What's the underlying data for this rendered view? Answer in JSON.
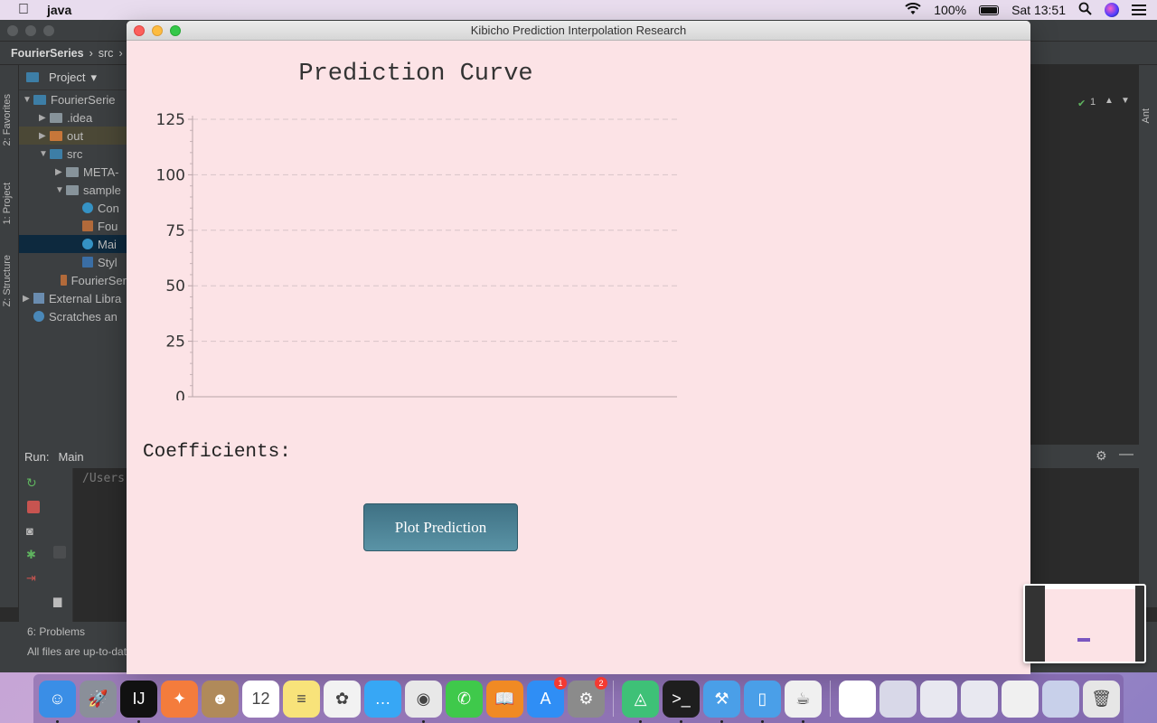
{
  "menubar": {
    "app_name": "java",
    "battery": "100%",
    "clock": "Sat 13:51"
  },
  "ide": {
    "breadcrumb": [
      "FourierSeries",
      "src"
    ],
    "project_label": "Project",
    "side_tabs": [
      "2: Favorites",
      "1: Project",
      "Z: Structure"
    ],
    "right_tab": "Ant",
    "tree": [
      {
        "label": "FourierSerie",
        "kind": "module",
        "indent": 0
      },
      {
        "label": ".idea",
        "kind": "folder",
        "indent": 1
      },
      {
        "label": "out",
        "kind": "folder-orange",
        "indent": 1
      },
      {
        "label": "src",
        "kind": "folder-blue",
        "indent": 1
      },
      {
        "label": "META-",
        "kind": "folder",
        "indent": 2
      },
      {
        "label": "sample",
        "kind": "folder",
        "indent": 2
      },
      {
        "label": "Con",
        "kind": "class",
        "indent": 3
      },
      {
        "label": "Fou",
        "kind": "file",
        "indent": 3
      },
      {
        "label": "Mai",
        "kind": "class",
        "indent": 3
      },
      {
        "label": "Styl",
        "kind": "css",
        "indent": 3
      },
      {
        "label": "FourierSer",
        "kind": "file",
        "indent": 2
      },
      {
        "label": "External Libra",
        "kind": "lib",
        "indent": 0
      },
      {
        "label": "Scratches an",
        "kind": "scratch",
        "indent": 0
      }
    ],
    "run_label": "Run:",
    "run_tab": "Main",
    "console_text": "/Users",
    "problems_tab": "6: Problems",
    "status_text": "All files are up-to-date",
    "inspection_count": "1"
  },
  "window": {
    "title": "Kibicho Prediction Interpolation Research",
    "coefficients_label": "Coefficients:",
    "plot_button_label": "Plot Prediction"
  },
  "chart_data": {
    "type": "line",
    "title": "Prediction Curve",
    "xlabel": "",
    "ylabel": "",
    "ylim": [
      0,
      125
    ],
    "y_ticks": [
      0,
      25,
      50,
      75,
      100,
      125
    ],
    "grid": true,
    "series": []
  },
  "dock": {
    "items": [
      {
        "name": "finder",
        "color": "#3a8ee6",
        "glyph": "☺",
        "running": true
      },
      {
        "name": "launchpad",
        "color": "#8a8f99",
        "glyph": "🚀",
        "running": false
      },
      {
        "name": "intellij",
        "color": "#111111",
        "glyph": "IJ",
        "running": true
      },
      {
        "name": "swift-playgrounds",
        "color": "#f47c3c",
        "glyph": "✦",
        "running": false
      },
      {
        "name": "contacts",
        "color": "#b08a5a",
        "glyph": "☻",
        "running": false
      },
      {
        "name": "calendar",
        "color": "#ffffff",
        "glyph": "12",
        "running": false
      },
      {
        "name": "notes",
        "color": "#f8e37a",
        "glyph": "≡",
        "running": false
      },
      {
        "name": "photos",
        "color": "#f2f2f2",
        "glyph": "✿",
        "running": false
      },
      {
        "name": "messages",
        "color": "#37a7f5",
        "glyph": "…",
        "running": false
      },
      {
        "name": "chrome",
        "color": "#e8e8e8",
        "glyph": "◉",
        "running": true
      },
      {
        "name": "facetime",
        "color": "#3fc94b",
        "glyph": "✆",
        "running": false
      },
      {
        "name": "books",
        "color": "#f08a24",
        "glyph": "📖",
        "running": false
      },
      {
        "name": "app-store",
        "color": "#2f8ef5",
        "glyph": "A",
        "running": false,
        "badge": "1"
      },
      {
        "name": "system-preferences",
        "color": "#8b8b8b",
        "glyph": "⚙",
        "running": false,
        "badge": "2"
      },
      {
        "name": "sep"
      },
      {
        "name": "android-studio",
        "color": "#3ec177",
        "glyph": "◬",
        "running": true
      },
      {
        "name": "terminal",
        "color": "#1e1e1e",
        "glyph": ">_",
        "running": true
      },
      {
        "name": "xcode",
        "color": "#4a9fe8",
        "glyph": "⚒",
        "running": true
      },
      {
        "name": "simulator",
        "color": "#4a9fe8",
        "glyph": "▯",
        "running": true
      },
      {
        "name": "java",
        "color": "#f0f0f0",
        "glyph": "☕",
        "running": true
      },
      {
        "name": "sep"
      },
      {
        "name": "document",
        "color": "#ffffff",
        "glyph": "",
        "running": false
      },
      {
        "name": "window-1",
        "color": "#d8d8e8",
        "glyph": "",
        "running": false
      },
      {
        "name": "window-2",
        "color": "#e8e8f0",
        "glyph": "",
        "running": false
      },
      {
        "name": "window-3",
        "color": "#e8e8f0",
        "glyph": "",
        "running": false
      },
      {
        "name": "window-4",
        "color": "#f0f0f0",
        "glyph": "",
        "running": false
      },
      {
        "name": "window-5",
        "color": "#c8d0ea",
        "glyph": "",
        "running": false
      },
      {
        "name": "trash",
        "color": "#e6e6e6",
        "glyph": "🗑",
        "running": false
      }
    ]
  }
}
